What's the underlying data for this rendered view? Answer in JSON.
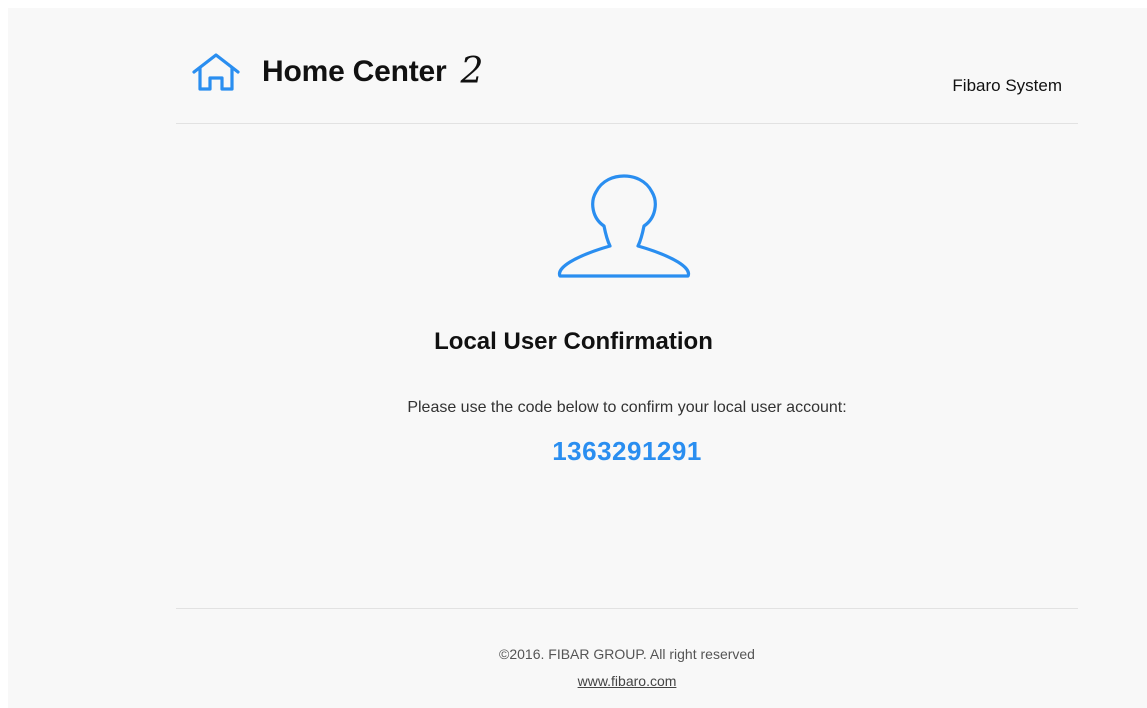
{
  "header": {
    "logo_text": "Home Center",
    "logo_number": "2",
    "brand": "Fibaro System"
  },
  "main": {
    "avatar_icon": "user-icon",
    "title": "Local User Confirmation",
    "message": "Please use the code below to confirm your local user account:",
    "code": "1363291291"
  },
  "footer": {
    "copyright": "©2016. FIBAR GROUP. All right reserved",
    "link": "www.fibaro.com"
  },
  "colors": {
    "accent": "#2a8ef0",
    "background": "#f8f8f8",
    "divider": "#e2e2e2"
  },
  "icons": {
    "logo": "home-icon",
    "avatar": "user-icon"
  }
}
